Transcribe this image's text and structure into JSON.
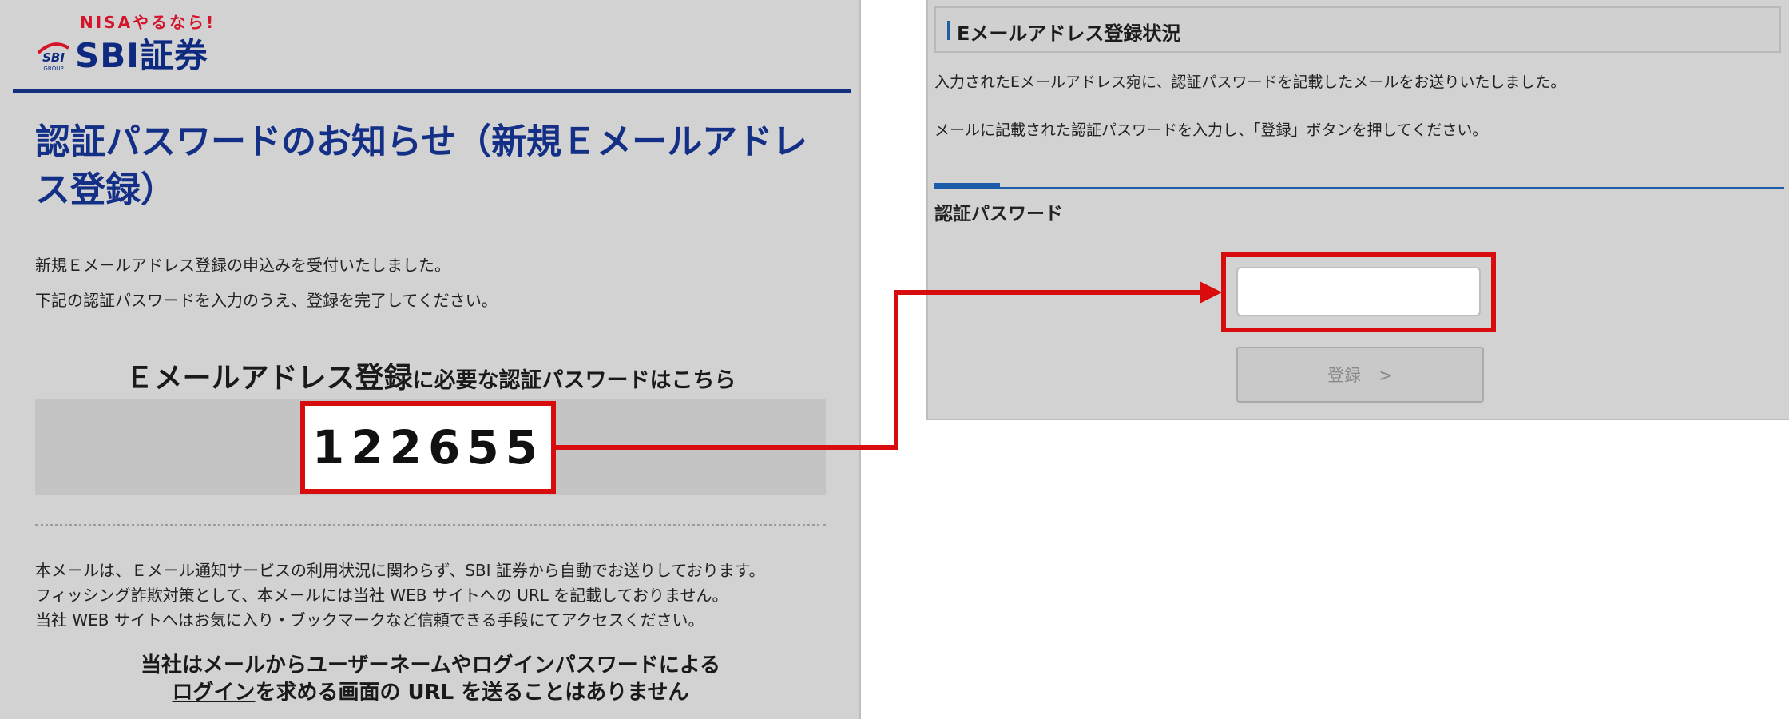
{
  "email": {
    "logo": {
      "tagline": "NISAやるなら!",
      "mark_text": "SBI",
      "mark_subtext": "GROUP",
      "brand": "SBI証券"
    },
    "title": "認証パスワードのお知らせ（新規Ｅメールアドレス登録）",
    "intro": [
      "新規Ｅメールアドレス登録の申込みを受付いたしました。",
      "下記の認証パスワードを入力のうえ、登録を完了してください。"
    ],
    "password_heading_main": "Ｅメールアドレス登録",
    "password_heading_sub": "に必要な認証パスワードはこちら",
    "password_code": "122655",
    "notices": [
      "本メールは、Ｅメール通知サービスの利用状況に関わらず、SBI 証券から自動でお送りしております。",
      "フィッシング詐欺対策として、本メールには当社 WEB サイトへの URL を記載しておりません。",
      "当社 WEB サイトへはお気に入り・ブックマークなど信頼できる手段にてアクセスください。"
    ],
    "warning_line1": "当社はメールからユーザーネームやログインパスワードによる",
    "warning_line2_underlined": "ログイン",
    "warning_line2_rest": "を求める画面の URL を送ることはありません"
  },
  "form": {
    "header_title": "Eメールアドレス登録状況",
    "messages": [
      "入力されたEメールアドレス宛に、認証パスワードを記載したメールをお送りいたしました。",
      "メールに記載された認証パスワードを入力し、「登録」ボタンを押してください。"
    ],
    "section_label": "認証パスワード",
    "password_input_value": "",
    "register_label": "登録",
    "register_chevron": ">"
  },
  "colors": {
    "highlight": "#d80c0c",
    "brand_navy": "#132f86",
    "brand_red": "#d3142a",
    "accent_blue": "#1d5ca8",
    "panel_gray": "#d2d2d2"
  }
}
